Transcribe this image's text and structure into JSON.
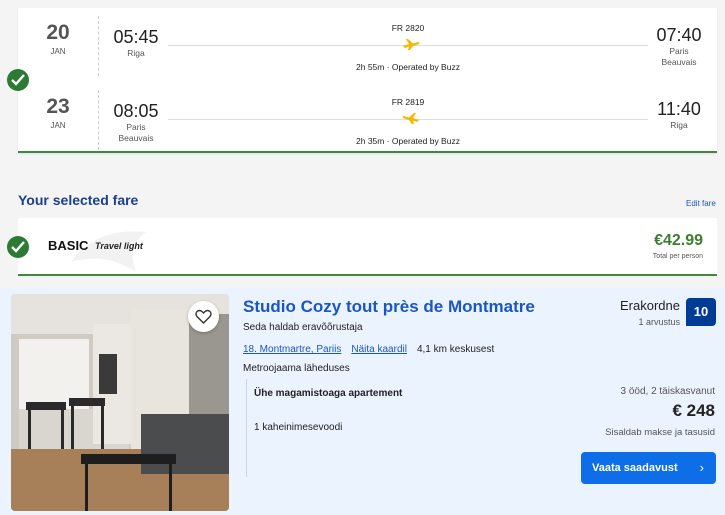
{
  "flights": [
    {
      "day": "20",
      "month": "JAN",
      "dep_time": "05:45",
      "dep_city": "Riga",
      "dep_city2": "",
      "flight_no": "FR 2820",
      "duration": "2h 55m · Operated by Buzz",
      "arr_time": "07:40",
      "arr_city": "Paris",
      "arr_city2": "Beauvais"
    },
    {
      "day": "23",
      "month": "JAN",
      "dep_time": "08:05",
      "dep_city": "Paris",
      "dep_city2": "Beauvais",
      "flight_no": "FR 2819",
      "duration": "2h 35m · Operated by Buzz",
      "arr_time": "11:40",
      "arr_city": "Riga",
      "arr_city2": ""
    }
  ],
  "fare": {
    "heading": "Your selected fare",
    "edit_label": "Edit fare",
    "name": "BASIC",
    "subtitle": "Travel light",
    "price": "€42.99",
    "per_person": "Total per person"
  },
  "hotel": {
    "title": "Studio Cozy tout près de Montmatre",
    "managed_by": "Seda haldab eravõõrustaja",
    "district_link": "18. Montmartre, Pariis",
    "map_link": "Näita kaardil",
    "distance": "4,1 km keskusest",
    "metro": "Metroojaama läheduses",
    "room_type": "Ühe magamistoaga apartement",
    "bed": "1 kaheinimesevoodi",
    "rating_word": "Erakordne",
    "rating_count": "1 arvustus",
    "score": "10",
    "nights": "3 ööd, 2 täiskasvanut",
    "price": "€ 248",
    "taxes": "Sisaldab makse ja tasusid",
    "cta_label": "Vaata saadavust",
    "cta_chevron": "›"
  },
  "colors": {
    "accent_green": "#2d7a35",
    "link_blue": "#1a56c4",
    "score_blue": "#003b95",
    "cta_blue": "#0d6ee8"
  },
  "icons": [
    "check-icon",
    "plane-icon",
    "heart-icon",
    "chevron-right-icon"
  ]
}
